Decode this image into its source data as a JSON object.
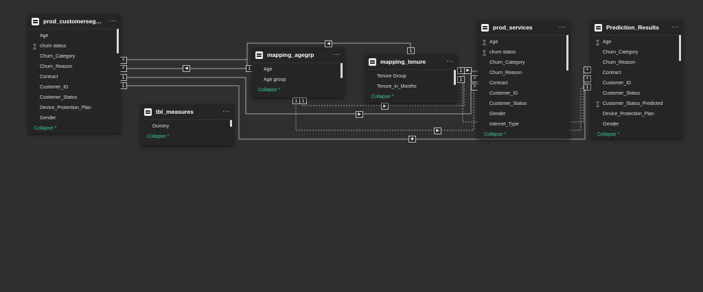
{
  "canvas": {
    "background": "#2f2f2f",
    "accent": "#3fc8a0"
  },
  "collapse_label": "Collapse",
  "tables": {
    "customersegment": {
      "title": "prod_customersegment...",
      "fields": [
        {
          "name": "Age",
          "sigma": false
        },
        {
          "name": "churn status",
          "sigma": true
        },
        {
          "name": "Churn_Category",
          "sigma": false
        },
        {
          "name": "Churn_Reason",
          "sigma": false
        },
        {
          "name": "Contract",
          "sigma": false
        },
        {
          "name": "Customer_ID",
          "sigma": false
        },
        {
          "name": "Customer_Status",
          "sigma": false
        },
        {
          "name": "Device_Protection_Plan",
          "sigma": false
        },
        {
          "name": "Gender",
          "sigma": false
        }
      ]
    },
    "tbl_measures": {
      "title": "tbl_measures",
      "fields": [
        {
          "name": "Dummy",
          "sigma": false
        }
      ]
    },
    "mapping_agegrp": {
      "title": "mapping_agegrp",
      "fields": [
        {
          "name": "Age",
          "sigma": false
        },
        {
          "name": "Age group",
          "sigma": false
        }
      ]
    },
    "mapping_tenure": {
      "title": "mapping_tenure",
      "fields": [
        {
          "name": "Tenure Group",
          "sigma": false
        },
        {
          "name": "Tenure_in_Months",
          "sigma": false
        }
      ]
    },
    "prod_services": {
      "title": "prod_services",
      "fields": [
        {
          "name": "Age",
          "sigma": true
        },
        {
          "name": "churn status",
          "sigma": true
        },
        {
          "name": "Churn_Category",
          "sigma": false
        },
        {
          "name": "Churn_Reason",
          "sigma": false
        },
        {
          "name": "Contract",
          "sigma": false
        },
        {
          "name": "Customer_ID",
          "sigma": false
        },
        {
          "name": "Customer_Status",
          "sigma": false
        },
        {
          "name": "Gender",
          "sigma": false
        },
        {
          "name": "Internet_Type",
          "sigma": false
        }
      ]
    },
    "prediction_results": {
      "title": "Prediction_Results",
      "fields": [
        {
          "name": "Age",
          "sigma": true
        },
        {
          "name": "Churn_Category",
          "sigma": false
        },
        {
          "name": "Churn_Reason",
          "sigma": false
        },
        {
          "name": "Contract",
          "sigma": false
        },
        {
          "name": "Customer_ID",
          "sigma": false
        },
        {
          "name": "Customer_Status",
          "sigma": false
        },
        {
          "name": "Customer_Status_Predicted",
          "sigma": true
        },
        {
          "name": "Device_Protection_Plan",
          "sigma": false
        },
        {
          "name": "Gender",
          "sigma": false
        }
      ]
    }
  },
  "cardinality": {
    "many": "*",
    "one": "1"
  }
}
